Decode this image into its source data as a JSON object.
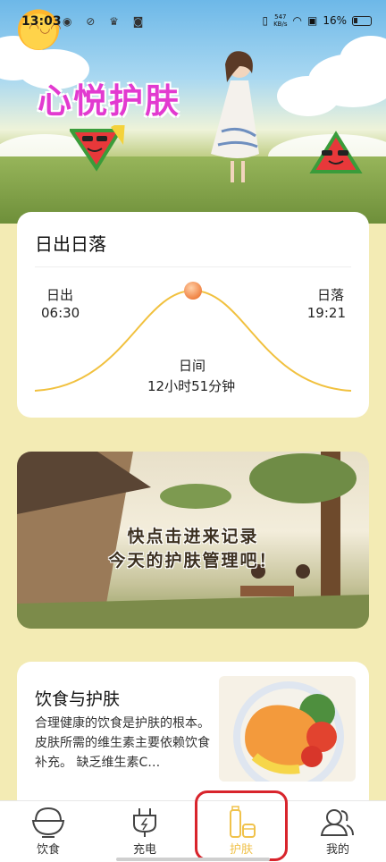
{
  "status_bar": {
    "time": "13:03",
    "net_speed_value": "547",
    "net_speed_unit": "KB/s",
    "battery_percent": "16%"
  },
  "header": {
    "app_title": "心悦护肤"
  },
  "sun_card": {
    "title": "日出日落",
    "sunrise_label": "日出",
    "sunrise_time": "06:30",
    "sunset_label": "日落",
    "sunset_time": "19:21",
    "day_label": "日间",
    "day_length": "12小时51分钟"
  },
  "banner": {
    "line1": "快点击进来记录",
    "line2": "今天的护肤管理吧！"
  },
  "diet_card": {
    "title": "饮食与护肤",
    "text": "合理健康的饮食是护肤的根本。皮肤所需的维生素主要依赖饮食补充。 缺乏维生素C…"
  },
  "tabs": [
    {
      "label": "饮食",
      "icon": "rice-bowl-icon",
      "active": false
    },
    {
      "label": "充电",
      "icon": "plug-icon",
      "active": false
    },
    {
      "label": "护肤",
      "icon": "skincare-bottle-icon",
      "active": true
    },
    {
      "label": "我的",
      "icon": "profile-icon",
      "active": false
    }
  ],
  "colors": {
    "page_background": "#f3ebb4",
    "title_pink": "#e23ad0",
    "active_tab": "#f0c24b",
    "sun_curve": "#f1c13f",
    "sun_dot": "#f08a4b",
    "highlight_red": "#d8242c"
  }
}
